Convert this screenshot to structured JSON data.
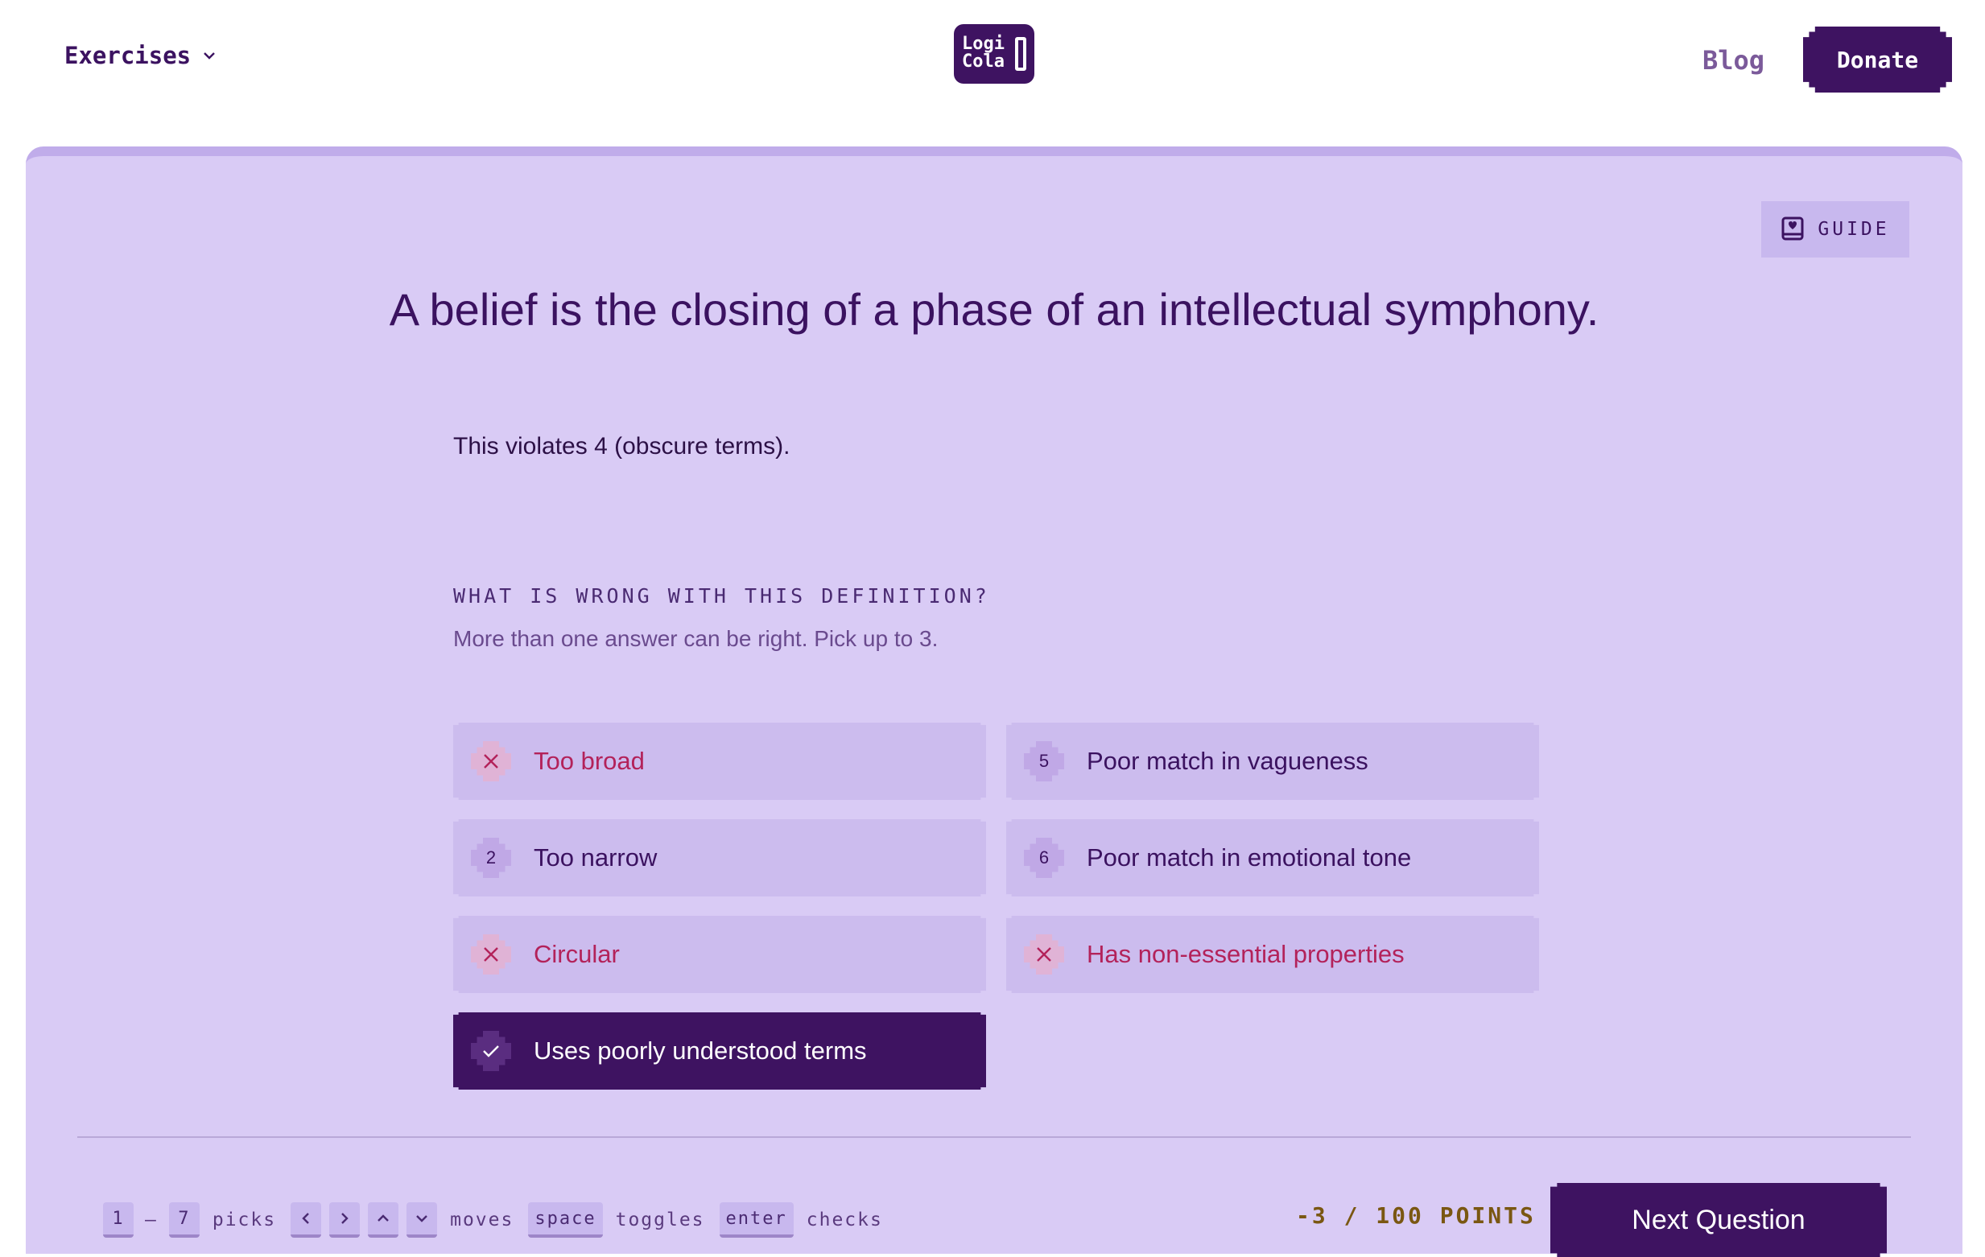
{
  "header": {
    "exercises_label": "Exercises",
    "logo_line1": "Logi",
    "logo_line2": "Cola",
    "blog_label": "Blog",
    "donate_label": "Donate"
  },
  "guide_label": "GUIDE",
  "question": "A belief is the closing of a phase of an intellectual symphony.",
  "feedback": "This violates 4 (obscure terms).",
  "prompt": {
    "heading": "WHAT IS WRONG WITH THIS DEFINITION?",
    "subtext": "More than one answer can be right. Pick up to 3."
  },
  "options": [
    {
      "badge": "",
      "state": "wrong",
      "label": "Too broad"
    },
    {
      "badge": "2",
      "state": "neutral",
      "label": "Too narrow"
    },
    {
      "badge": "",
      "state": "wrong",
      "label": "Circular"
    },
    {
      "badge": "",
      "state": "correct",
      "label": "Uses poorly understood terms"
    },
    {
      "badge": "5",
      "state": "neutral",
      "label": "Poor match in vagueness"
    },
    {
      "badge": "6",
      "state": "neutral",
      "label": "Poor match in emotional tone"
    },
    {
      "badge": "",
      "state": "wrong",
      "label": "Has non-essential properties"
    }
  ],
  "shortcuts": {
    "key_first": "1",
    "dash": "–",
    "key_last": "7",
    "picks": "picks",
    "moves": "moves",
    "space_key": "space",
    "toggles": "toggles",
    "enter_key": "enter",
    "checks": "checks"
  },
  "points": "-3 / 100 POINTS",
  "next_label": "Next Question",
  "colors": {
    "panel_bg": "#d9cbf5",
    "primary": "#3e1361",
    "wrong": "#b3225a",
    "points": "#7a5712"
  }
}
